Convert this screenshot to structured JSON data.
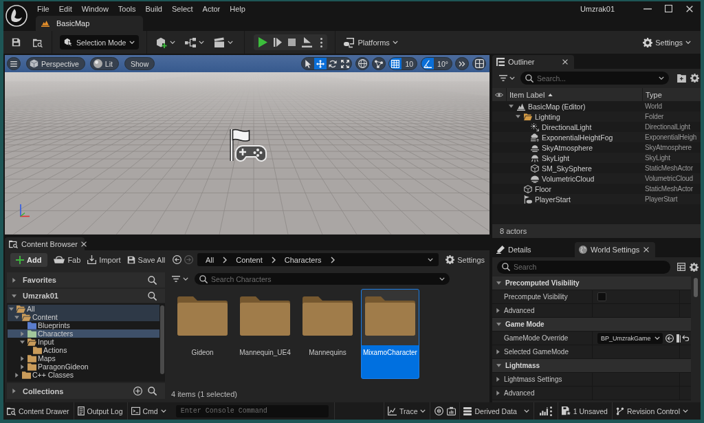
{
  "window": {
    "title": "Umzrak01",
    "menu": [
      "File",
      "Edit",
      "Window",
      "Tools",
      "Build",
      "Select",
      "Actor",
      "Help"
    ],
    "document_tab": "BasicMap"
  },
  "toolbar": {
    "mode": "Selection Mode",
    "platforms": "Platforms",
    "settings": "Settings"
  },
  "viewport": {
    "view": "Perspective",
    "lighting": "Lit",
    "show": "Show",
    "transform_tools": [
      {
        "kind": "select",
        "selected": false
      },
      {
        "kind": "move",
        "selected": true
      },
      {
        "kind": "rotate",
        "selected": false
      },
      {
        "kind": "scale",
        "selected": false
      }
    ],
    "grid_snap": {
      "on": true,
      "value": "10"
    },
    "angle_snap": {
      "on": true,
      "value": "10°"
    }
  },
  "outliner": {
    "tab": "Outliner",
    "search": {
      "placeholder": "Search..."
    },
    "columns": [
      "Item Label",
      "Type"
    ],
    "rows": [
      {
        "label": "BasicMap (Editor)",
        "type": "World",
        "kind": "world",
        "expanded": true,
        "selected": false,
        "children": [
          {
            "label": "Lighting",
            "type": "Folder",
            "kind": "folder",
            "expanded": true,
            "selected": false,
            "children": [
              {
                "label": "DirectionalLight",
                "type": "DirectionalLight",
                "kind": "directional",
                "selected": false
              },
              {
                "label": "ExponentialHeightFog",
                "type": "ExponentialHeigh",
                "kind": "fog",
                "selected": false
              },
              {
                "label": "SkyAtmosphere",
                "type": "SkyAtmosphere",
                "kind": "atmosphere",
                "selected": false
              },
              {
                "label": "SkyLight",
                "type": "SkyLight",
                "kind": "skylight",
                "selected": false
              },
              {
                "label": "SM_SkySphere",
                "type": "StaticMeshActor",
                "kind": "mesh",
                "selected": false
              },
              {
                "label": "VolumetricCloud",
                "type": "VolumetricCloud",
                "kind": "cloud",
                "selected": false
              }
            ]
          },
          {
            "label": "Floor",
            "type": "StaticMeshActor",
            "kind": "mesh",
            "selected": false
          },
          {
            "label": "PlayerStart",
            "type": "PlayerStart",
            "kind": "playerstart",
            "selected": false
          }
        ]
      }
    ],
    "footer": "8 actors"
  },
  "content_browser": {
    "tab": "Content Browser",
    "add": "Add",
    "fab": "Fab",
    "import": "Import",
    "save_all": "Save All",
    "navigation": {
      "back": {
        "disabled": false
      },
      "forward": {
        "disabled": true
      }
    },
    "path": [
      "All",
      "Content",
      "Characters"
    ],
    "settings": "Settings",
    "favorites": {
      "label": "Favorites",
      "expanded": false
    },
    "project": {
      "label": "Umzrak01",
      "expanded": true,
      "tree": [
        {
          "label": "All",
          "expanded": true,
          "selected": false,
          "highlighted": true,
          "color": "#c99b5a",
          "children": [
            {
              "label": "Content",
              "expanded": true,
              "selected": false,
              "highlighted": true,
              "color": "#c99b5a",
              "children": [
                {
                  "label": "Blueprints",
                  "selected": false,
                  "highlighted": false,
                  "color": "#5a7ccc"
                },
                {
                  "label": "Characters",
                  "expanded": false,
                  "selected": true,
                  "highlighted": false,
                  "color": "#a3c79c"
                },
                {
                  "label": "Input",
                  "expanded": true,
                  "selected": false,
                  "highlighted": false,
                  "color": "#c99b5a",
                  "children": [
                    {
                      "label": "Actions",
                      "selected": false,
                      "highlighted": false,
                      "color": "#c99b5a"
                    }
                  ]
                },
                {
                  "label": "Maps",
                  "expanded": false,
                  "selected": false,
                  "highlighted": false,
                  "color": "#c99b5a"
                },
                {
                  "label": "ParagonGideon",
                  "expanded": false,
                  "selected": false,
                  "highlighted": false,
                  "color": "#c99b5a"
                }
              ]
            },
            {
              "label": "C++ Classes",
              "expanded": false,
              "selected": false,
              "highlighted": false,
              "color": "#c99b5a"
            }
          ]
        }
      ]
    },
    "collections": {
      "label": "Collections",
      "expanded": false
    },
    "search": {
      "placeholder": "Search Characters"
    },
    "assets": [
      {
        "label": "Gideon",
        "selected": false
      },
      {
        "label": "Mannequin_UE4",
        "selected": false
      },
      {
        "label": "Mannequins",
        "selected": false
      },
      {
        "label": "MixamoCharacter",
        "selected": true
      }
    ],
    "count": "4 items (1 selected)"
  },
  "details": {
    "tabs": [
      {
        "label": "Details",
        "selected": false
      },
      {
        "label": "World Settings",
        "selected": true
      }
    ],
    "search": {
      "placeholder": "Search"
    },
    "rows": [
      {
        "kind": "category",
        "label": "Precomputed Visibility",
        "expanded": true
      },
      {
        "kind": "checkbox",
        "label": "Precompute Visibility",
        "checked": false
      },
      {
        "kind": "group",
        "label": "Advanced",
        "expanded": false
      },
      {
        "kind": "category",
        "label": "Game Mode",
        "expanded": true
      },
      {
        "kind": "dropdown",
        "label": "GameMode Override",
        "value": "BP_UmzrakGame"
      },
      {
        "kind": "group",
        "label": "Selected GameMode",
        "expanded": false
      },
      {
        "kind": "category",
        "label": "Lightmass",
        "expanded": true
      },
      {
        "kind": "group",
        "label": "Lightmass Settings",
        "expanded": false
      },
      {
        "kind": "group",
        "label": "Advanced",
        "expanded": false
      }
    ]
  },
  "status_bar": {
    "content_drawer": "Content Drawer",
    "output_log": "Output Log",
    "cmd": "Cmd",
    "console": {
      "placeholder": "Enter Console Command"
    },
    "trace": "Trace",
    "derived_data": "Derived Data",
    "unsaved": "1 Unsaved",
    "revision_control": "Revision Control"
  }
}
